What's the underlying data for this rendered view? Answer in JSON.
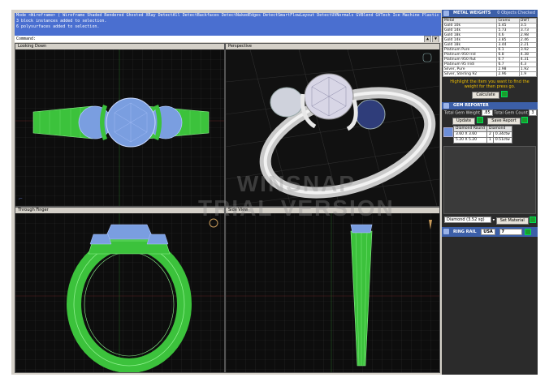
{
  "command": {
    "lines": [
      "Mode <Wireframe> ( Wireframe  Shaded  Rendered  Ghosted  XRay  DetectAll  DetectBackfaces  DetectNakedEdges  DetectSmartFlowLayout  DetectUVNormals  GVBlend  GVTech  Ice  Machine  Plastic  Presentation",
      "3 block instances added to selection.",
      "6 polysurfaces added to selection."
    ],
    "prompt": "Command:"
  },
  "viewports": {
    "top_left": "Looking Down",
    "top_right": "Perspective",
    "bottom_left": "Through Finger",
    "bottom_right": "Side View"
  },
  "watermark": [
    "WINSNAP",
    "TRIAL VERSION"
  ],
  "metal_weights": {
    "title": "METAL WEIGHTS",
    "subtitle": "0 Objects Checked",
    "columns": [
      "Metal",
      "Grams",
      "DWT"
    ],
    "rows": [
      [
        "Gold 10k",
        "5.45",
        "3.5"
      ],
      [
        "Gold 14k",
        "5.73",
        "3.73"
      ],
      [
        "Gold 18k",
        "4.6",
        "2.98"
      ],
      [
        "Gold 14k",
        "3.85",
        "2.46"
      ],
      [
        "Gold 18k",
        "3.44",
        "2.21"
      ],
      [
        "Platinum Pure",
        "6.1",
        "3.92"
      ],
      [
        "Platinum 950 Irid",
        "6.8",
        "4.38"
      ],
      [
        "Platinum 950 Rut",
        "6.7",
        "4.31"
      ],
      [
        "Platinum 95 Iridi",
        "6.7",
        "4.3"
      ],
      [
        "Silver, Pure",
        "2.98",
        "1.92"
      ],
      [
        "Silver, Sterling 92",
        "2.96",
        "1.9"
      ]
    ],
    "hint": "Highlight the item you want to find the weight for then press go.",
    "calculate": "Calculate"
  },
  "gem_reporter": {
    "title": "GEM REPORTER",
    "total_weight_label": "Total Gem Weight",
    "total_weight": ".85",
    "total_count_label": "Total Gem Count",
    "total_count": "3",
    "update": "Update",
    "save_report": "Save Report",
    "columns": [
      "Diamond Round",
      "Diamond"
    ],
    "rows": [
      [
        "3.60 X 3.60",
        "2",
        "0.34ctw"
      ],
      [
        "5.20 X 5.20",
        "1",
        "0.51ctw"
      ]
    ],
    "material_select": "Diamond   (3.52 sg)",
    "set_material": "Set Material"
  },
  "ring_rail": {
    "title": "RING RAIL",
    "country": "USA",
    "size": "7"
  }
}
